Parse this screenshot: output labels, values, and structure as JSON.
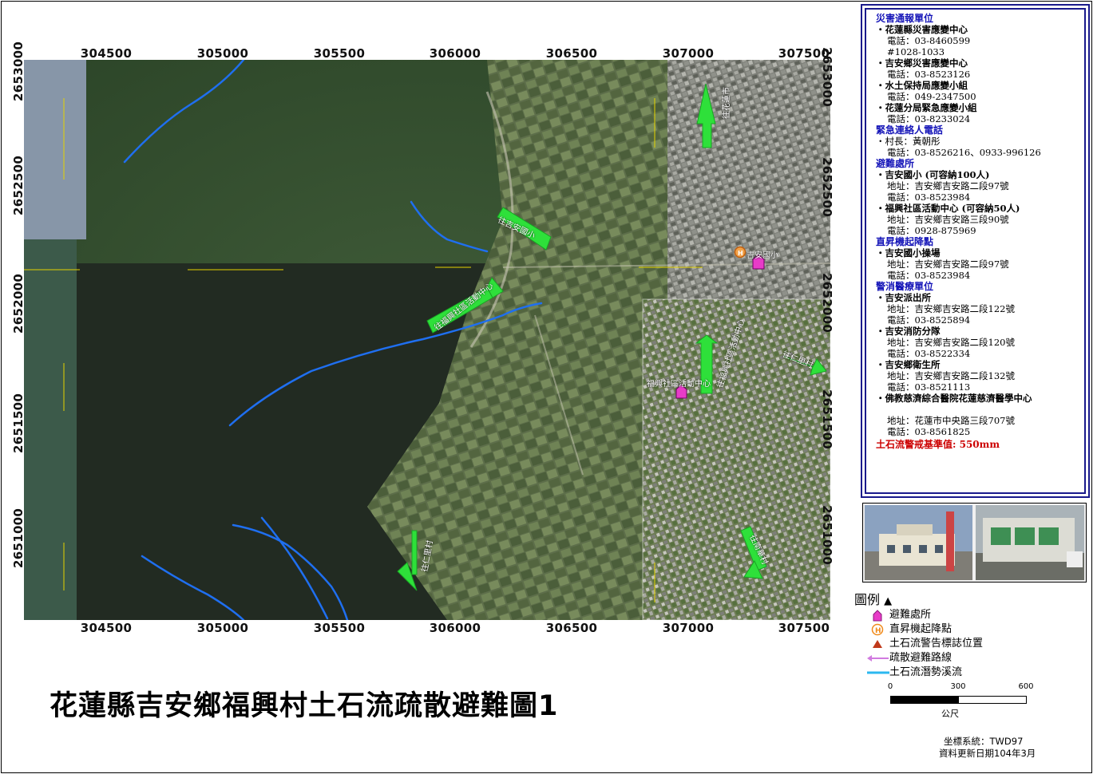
{
  "title": "花蓮縣吉安鄉福興村土石流疏散避難圖1",
  "axis_ticks": {
    "x_top": [
      "304500",
      "305000",
      "305500",
      "306000",
      "306500",
      "307000",
      "307500"
    ],
    "x_bottom": [
      "304500",
      "305000",
      "305500",
      "306000",
      "306500",
      "307000",
      "307500"
    ],
    "y_left": [
      "2653000",
      "2652500",
      "2652000",
      "2651500",
      "2651000"
    ],
    "y_right": [
      "2653000",
      "2652500",
      "2652000",
      "2651500",
      "2651000"
    ]
  },
  "map_labels": {
    "route_arrows": [
      "往花蓮市",
      "往吉安國小",
      "往福興社區活動中心",
      "往福興社區活動中心",
      "往仁里村",
      "往南華村",
      "往仁里村"
    ],
    "place_labels": [
      "吉安國小",
      "福興社區活動中心"
    ]
  },
  "info_panel": {
    "sections": [
      {
        "heading": "災害通報單位",
        "entries": [
          {
            "name": "花蓮縣災害應變中心",
            "lines": [
              "電話：03-8460599",
              "#1028-1033"
            ]
          },
          {
            "name": "吉安鄉災害應變中心",
            "lines": [
              "電話：03-8523126"
            ]
          },
          {
            "name": "水土保持局應變小組",
            "lines": [
              "電話：049-2347500"
            ]
          },
          {
            "name": "花蓮分局緊急應變小組",
            "lines": [
              "電話：03-8233024"
            ]
          }
        ]
      },
      {
        "heading": "緊急連絡人電話",
        "entries": [
          {
            "name": "村長：黃朝彤",
            "lines": [
              "電話：03-8526216、0933-996126"
            ]
          }
        ]
      },
      {
        "heading": "避難處所",
        "entries": [
          {
            "name": "吉安國小 (可容納100人)",
            "lines": [
              "地址：吉安鄉吉安路二段97號",
              "電話：03-8523984"
            ]
          },
          {
            "name": "福興社區活動中心 (可容納50人)",
            "lines": [
              "地址：吉安鄉吉安路三段90號",
              "電話：0928-875969"
            ]
          }
        ]
      },
      {
        "heading": "直昇機起降點",
        "entries": [
          {
            "name": "吉安國小操場",
            "lines": [
              "地址：吉安鄉吉安路二段97號",
              "電話：03-8523984"
            ]
          }
        ]
      },
      {
        "heading": "警消醫療單位",
        "entries": [
          {
            "name": "吉安派出所",
            "lines": [
              "地址：吉安鄉吉安路二段122號",
              "電話：03-8525894"
            ]
          },
          {
            "name": "吉安消防分隊",
            "lines": [
              "地址：吉安鄉吉安路二段120號",
              "電話：03-8522334"
            ]
          },
          {
            "name": "吉安鄉衛生所",
            "lines": [
              "地址：吉安鄉吉安路二段132號",
              "電話：03-8521113"
            ]
          },
          {
            "name": "佛教慈濟綜合醫院花蓮慈濟醫學中心",
            "lines": [
              "",
              "地址：花蓮市中央路三段707號",
              "電話：03-8561825"
            ]
          }
        ]
      }
    ],
    "threshold": "土石流警戒基準值: 550mm"
  },
  "legend": {
    "title": "圖例",
    "items": [
      {
        "label": "避難處所",
        "icon": "shelter-house-icon",
        "color": "#e83cc8"
      },
      {
        "label": "直昇機起降點",
        "icon": "helipad-icon",
        "color": "#f08a1a"
      },
      {
        "label": "土石流警告標誌位置",
        "icon": "warning-triangle-icon",
        "color": "#c0391b"
      },
      {
        "label": "疏散避難路線",
        "icon": "evacuation-arrow-icon",
        "color": "#d17be0"
      },
      {
        "label": "土石流潛勢溪流",
        "icon": "stream-line-icon",
        "color": "#2bb8f0"
      }
    ]
  },
  "scale_bar": {
    "labels": [
      "0",
      "300",
      "600"
    ],
    "unit": "公尺"
  },
  "footer": {
    "coord_system": "坐標系統：TWD97",
    "update_date": "資料更新日期104年3月"
  },
  "colors": {
    "panel_border": "#1a1a8c",
    "section_heading": "#1515b8",
    "threshold": "#cc0000",
    "route_arrow": "#2ee03a",
    "stream": "#1f6ff0"
  }
}
